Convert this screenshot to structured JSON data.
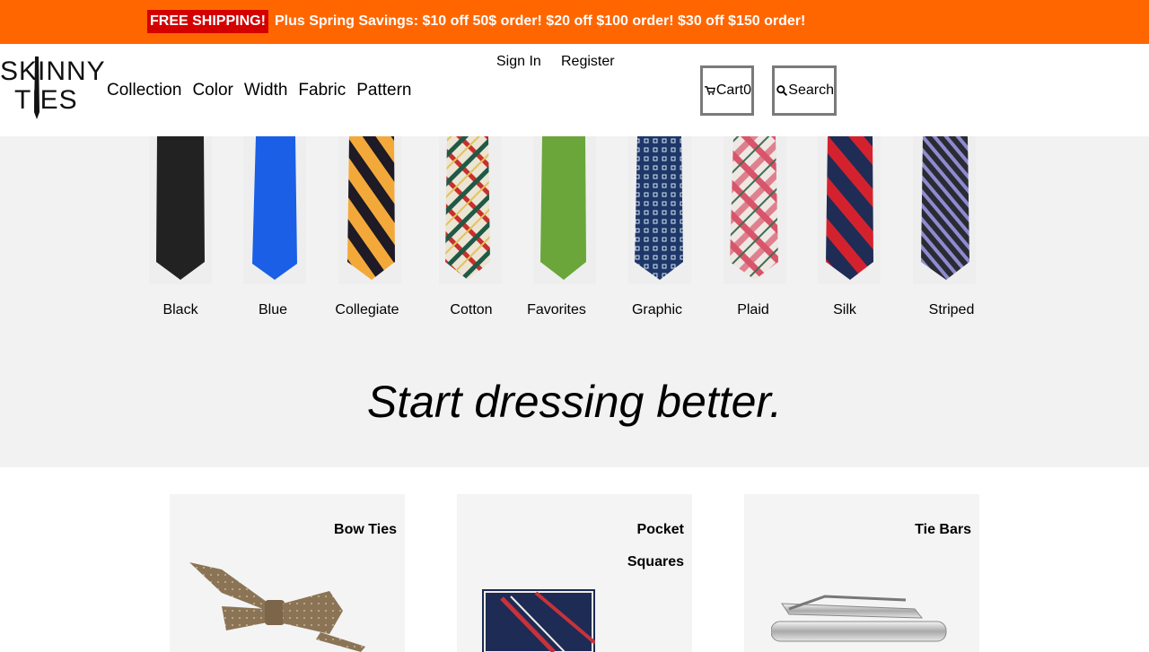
{
  "promo": {
    "badge": "FREE SHIPPING!",
    "message": "Plus Spring Savings: $10 off 50$ order! $20 off $100 order! $30 off $150 order!"
  },
  "logo": {
    "line1": "SKINNY",
    "line2": "TIES"
  },
  "nav": [
    "Collection",
    "Color",
    "Width",
    "Fabric",
    "Pattern"
  ],
  "account": {
    "sign_in": "Sign In",
    "register": "Register"
  },
  "cart": {
    "label": "Cart",
    "count": "0"
  },
  "search": {
    "label": "Search"
  },
  "ties": [
    {
      "label": "Black",
      "color": "#222222"
    },
    {
      "label": "Blue",
      "color": "#1a5fe6"
    },
    {
      "label": "Collegiate",
      "color": "#f3a93a"
    },
    {
      "label": "Cotton",
      "color": "#e9e2d2"
    },
    {
      "label": "Favorites",
      "color": "#6aa63a"
    },
    {
      "label": "Graphic",
      "color": "#1c3768"
    },
    {
      "label": "Plaid",
      "color": "#e8b9c0"
    },
    {
      "label": "Silk",
      "color": "#1f2c55"
    },
    {
      "label": "Striped",
      "color": "#555569"
    }
  ],
  "tagline": "Start dressing better.",
  "categories": [
    {
      "title_line1": "Bow Ties",
      "title_line2": ""
    },
    {
      "title_line1": "Pocket",
      "title_line2": "Squares"
    },
    {
      "title_line1": "Tie Bars",
      "title_line2": ""
    }
  ],
  "colors": {
    "promo_bg": "#ff6600",
    "badge_bg": "#d40000",
    "hero_bg": "#f2f2f2"
  }
}
